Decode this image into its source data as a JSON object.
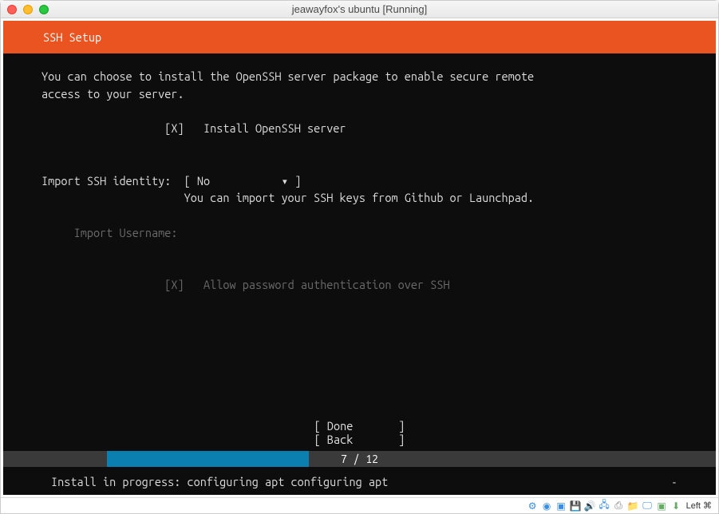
{
  "window": {
    "title": "jeawayfox's ubuntu [Running]"
  },
  "installer": {
    "header": "SSH Setup",
    "description": "You can choose to install the OpenSSH server package to enable secure remote\naccess to your server.",
    "install_checkbox": {
      "mark": "[X]",
      "label": "Install OpenSSH server"
    },
    "import_identity": {
      "label": "Import SSH identity:",
      "value_open": "[ ",
      "value": "No",
      "value_arrow": "▾",
      "value_close": " ]",
      "hint": "You can import your SSH keys from Github or Launchpad."
    },
    "import_username": {
      "label": "Import Username:"
    },
    "allow_password": {
      "mark": "[X]",
      "label": "Allow password authentication over SSH"
    },
    "nav": {
      "done_open": "[ ",
      "done": "Done",
      "done_close": "       ]",
      "back_open": "[ ",
      "back": "Back",
      "back_close": "       ]"
    },
    "progress": {
      "text": "7 / 12",
      "percent": 40
    },
    "status": {
      "prefix": "Install in progress: ",
      "text": "configuring apt configuring apt",
      "spinner": "-"
    }
  },
  "statusbar": {
    "hostkey": "Left ⌘"
  },
  "colors": {
    "ubuntu_orange": "#e95420",
    "progress_blue": "#0a7fb0",
    "progress_bg": "#3a3a3a"
  }
}
